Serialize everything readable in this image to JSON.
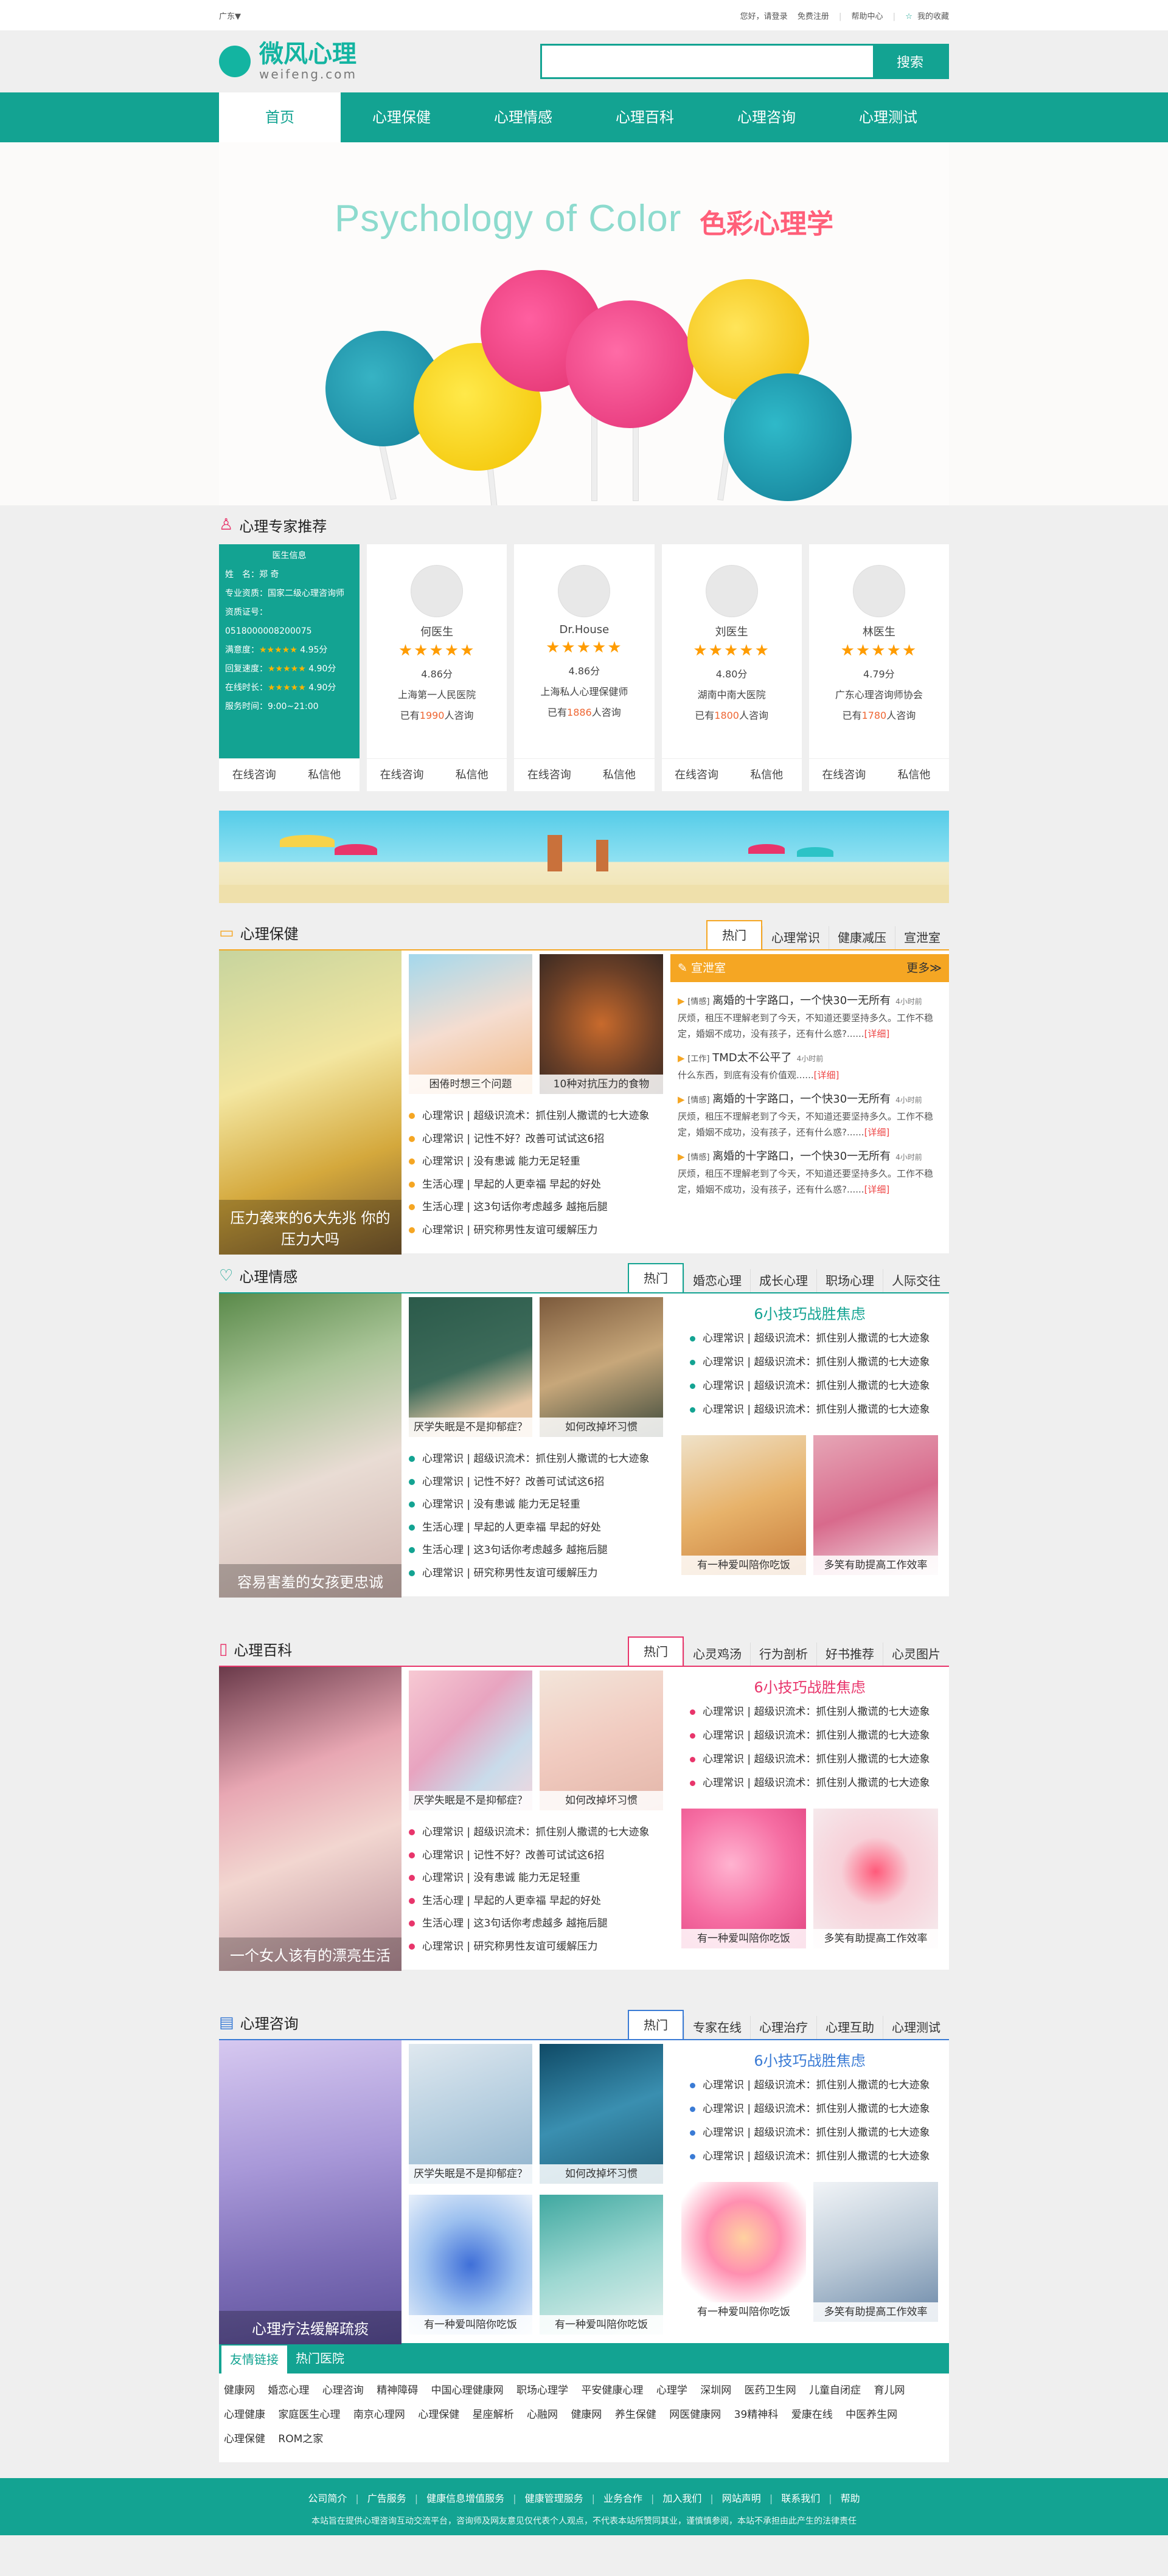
{
  "topbar": {
    "region": "广东▼",
    "login": "您好，请登录",
    "register": "免费注册",
    "help": "帮助中心",
    "fav": "我的收藏"
  },
  "logo": {
    "cn": "微风心理",
    "en": "weifeng.com"
  },
  "search": {
    "placeholder": "",
    "button": "搜索"
  },
  "nav": [
    "首页",
    "心理保健",
    "心理情感",
    "心理百科",
    "心理咨询",
    "心理测试"
  ],
  "banner": {
    "title": "Psychology of Color",
    "cn": "色彩心理学"
  },
  "experts": {
    "title": "心理专家推荐",
    "info": {
      "head": "医生信息",
      "name": "姓　名：郑 奇",
      "qual": "专业资质：国家二级心理咨询师",
      "cert": "资质证号：0518000008200075",
      "s1": "满意度：",
      "v1": "4.95分",
      "s2": "回复速度：",
      "v2": "4.90分",
      "s3": "在线时长：",
      "v3": "4.90分",
      "time": "服务时间：9:00~21:00"
    },
    "cards": [
      {
        "name": "何医生",
        "score": "4.86分",
        "hospital": "上海第一人民医院",
        "pre": "已有",
        "count": "1990",
        "post": "人咨询"
      },
      {
        "name": "Dr.House",
        "score": "4.86分",
        "hospital": "上海私人心理保健师",
        "pre": "已有",
        "count": "1886",
        "post": "人咨询"
      },
      {
        "name": "刘医生",
        "score": "4.80分",
        "hospital": "湖南中南大医院",
        "pre": "已有",
        "count": "1800",
        "post": "人咨询"
      },
      {
        "name": "林医生",
        "score": "4.79分",
        "hospital": "广东心理咨询师协会",
        "pre": "已有",
        "count": "1780",
        "post": "人咨询"
      }
    ],
    "btn1": "在线咨询",
    "btn2": "私信他"
  },
  "s1": {
    "title": "心理保健",
    "tabs": [
      "热门",
      "心理常识",
      "健康减压",
      "宣泄室"
    ],
    "bigcap": "压力袭来的6大先兆  你的压力大吗",
    "t1": "困倦时想三个问题",
    "t2": "10种对抗压力的食物",
    "list": [
      "心理常识 | 超级识流术：抓住别人撒谎的七大迹象",
      "心理常识 | 记性不好？改善可试试这6招",
      "心理常识 | 没有患诚  能力无足轻重",
      "生活心理 | 早起的人更幸福  早起的好处",
      "生活心理 | 这3句话你考虑越多  越拖后腿",
      "心理常识 | 研究称男性友谊可缓解压力"
    ],
    "hot": "宣泄室",
    "more": "更多≫",
    "news": [
      {
        "tag": "[情感]",
        "title": "离婚的十字路口，一个快30一无所有",
        "time": "4小时前",
        "desc": "厌烦，租压不理解老到了今天，不知道还要坚持多久。工作不稳定，婚姻不成功，没有孩子，还有什么惑?......",
        "more": "[详细]"
      },
      {
        "tag": "[工作]",
        "title": "TMD太不公平了",
        "time": "4小时前",
        "desc": "什么东西，到底有没有价值观......",
        "more": "[详细]"
      },
      {
        "tag": "[情感]",
        "title": "离婚的十字路口，一个快30一无所有",
        "time": "4小时前",
        "desc": "厌烦，租压不理解老到了今天，不知道还要坚持多久。工作不稳定，婚姻不成功，没有孩子，还有什么惑?......",
        "more": "[详细]"
      },
      {
        "tag": "[情感]",
        "title": "离婚的十字路口，一个快30一无所有",
        "time": "4小时前",
        "desc": "厌烦，租压不理解老到了今天，不知道还要坚持多久。工作不稳定，婚姻不成功，没有孩子，还有什么惑?......",
        "more": "[详细]"
      }
    ]
  },
  "s2": {
    "title": "心理情感",
    "tabs": [
      "热门",
      "婚恋心理",
      "成长心理",
      "职场心理",
      "人际交往"
    ],
    "bigcap": "容易害羞的女孩更忠诚",
    "t1": "厌学失眠是不是抑郁症？",
    "t2": "如何改掉坏习惯",
    "list": [
      "心理常识 | 超级识流术：抓住别人撒谎的七大迹象",
      "心理常识 | 记性不好？改善可试试这6招",
      "心理常识 | 没有患诚  能力无足轻重",
      "生活心理 | 早起的人更幸福  早起的好处",
      "生活心理 | 这3句话你考虑越多  越拖后腿",
      "心理常识 | 研究称男性友谊可缓解压力"
    ],
    "rtitle": "6小技巧战胜焦虑",
    "rlist": [
      "心理常识 | 超级识流术：抓住别人撒谎的七大迹象",
      "心理常识 | 超级识流术：抓住别人撒谎的七大迹象",
      "心理常识 | 超级识流术：抓住别人撒谎的七大迹象",
      "心理常识 | 超级识流术：抓住别人撒谎的七大迹象"
    ],
    "r1": "有一种爱叫陪你吃饭",
    "r2": "多笑有助提高工作效率"
  },
  "s3": {
    "title": "心理百科",
    "tabs": [
      "热门",
      "心灵鸡汤",
      "行为剖析",
      "好书推荐",
      "心灵图片"
    ],
    "bigcap": "一个女人该有的漂亮生活",
    "t1": "厌学失眠是不是抑郁症？",
    "t2": "如何改掉坏习惯",
    "list": [
      "心理常识 | 超级识流术：抓住别人撒谎的七大迹象",
      "心理常识 | 记性不好？改善可试试这6招",
      "心理常识 | 没有患诚  能力无足轻重",
      "生活心理 | 早起的人更幸福  早起的好处",
      "生活心理 | 这3句话你考虑越多  越拖后腿",
      "心理常识 | 研究称男性友谊可缓解压力"
    ],
    "rtitle": "6小技巧战胜焦虑",
    "rlist": [
      "心理常识 | 超级识流术：抓住别人撒谎的七大迹象",
      "心理常识 | 超级识流术：抓住别人撒谎的七大迹象",
      "心理常识 | 超级识流术：抓住别人撒谎的七大迹象",
      "心理常识 | 超级识流术：抓住别人撒谎的七大迹象"
    ],
    "r1": "有一种爱叫陪你吃饭",
    "r2": "多笑有助提高工作效率"
  },
  "s4": {
    "title": "心理咨询",
    "tabs": [
      "热门",
      "专家在线",
      "心理治疗",
      "心理互助",
      "心理测试"
    ],
    "bigcap": "心理疗法缓解疏痰",
    "t1": "厌学失眠是不是抑郁症？",
    "t2": "如何改掉坏习惯",
    "t3": "有一种爱叫陪你吃饭",
    "t4": "有一种爱叫陪你吃饭",
    "rtitle": "6小技巧战胜焦虑",
    "rlist": [
      "心理常识 | 超级识流术：抓住别人撒谎的七大迹象",
      "心理常识 | 超级识流术：抓住别人撒谎的七大迹象",
      "心理常识 | 超级识流术：抓住别人撒谎的七大迹象",
      "心理常识 | 超级识流术：抓住别人撒谎的七大迹象"
    ],
    "r1": "有一种爱叫陪你吃饭",
    "r2": "多笑有助提高工作效率"
  },
  "links": {
    "tab1": "友情链接",
    "tab2": "热门医院",
    "items": [
      "健康网",
      "婚恋心理",
      "心理咨询",
      "精神障碍",
      "中国心理健康网",
      "职场心理学",
      "平安健康心理",
      "心理学",
      "深圳网",
      "医药卫生网",
      "儿童自闭症",
      "育儿网",
      "心理健康",
      "家庭医生心理",
      "南京心理网",
      "心理保健",
      "星座解析",
      "心融网",
      "健康网",
      "养生保健",
      "网医健康网",
      "39精神科",
      "爱康在线",
      "中医养生网",
      "心理保健",
      "ROM之家"
    ]
  },
  "footer": {
    "links": [
      "公司简介",
      "广告服务",
      "健康信息增值服务",
      "健康管理服务",
      "业务合作",
      "加入我们",
      "网站声明",
      "联系我们",
      "帮助"
    ],
    "copy": "本站旨在提供心理咨询互动交流平台，咨询师及网友意见仅代表个人观点，不代表本站所赞同其业，谨慎慎参阅，本站不承担由此产生的法律责任"
  },
  "colors": {
    "teal": "#13a392",
    "orange": "#f5a623",
    "pink": "#e8356b",
    "blue": "#3a7bd5"
  }
}
